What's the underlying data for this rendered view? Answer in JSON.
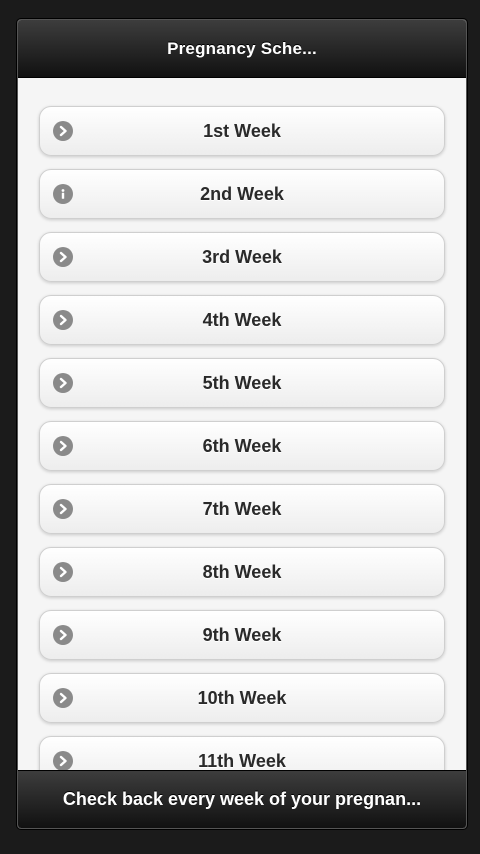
{
  "header": {
    "title": "Pregnancy Sche..."
  },
  "list": {
    "items": [
      {
        "label": "1st Week",
        "icon": "arrow-right-icon"
      },
      {
        "label": "2nd Week",
        "icon": "info-icon"
      },
      {
        "label": "3rd Week",
        "icon": "arrow-right-icon"
      },
      {
        "label": "4th Week",
        "icon": "arrow-right-icon"
      },
      {
        "label": "5th Week",
        "icon": "arrow-right-icon"
      },
      {
        "label": "6th Week",
        "icon": "arrow-right-icon"
      },
      {
        "label": "7th Week",
        "icon": "arrow-right-icon"
      },
      {
        "label": "8th Week",
        "icon": "arrow-right-icon"
      },
      {
        "label": "9th Week",
        "icon": "arrow-right-icon"
      },
      {
        "label": "10th Week",
        "icon": "arrow-right-icon"
      },
      {
        "label": "11th Week",
        "icon": "arrow-right-icon"
      }
    ]
  },
  "footer": {
    "text": "Check back every week of your pregnan..."
  },
  "colors": {
    "bar": "#1f1f1f",
    "background": "#f5f5f5",
    "icon": "#8a8a8a"
  }
}
